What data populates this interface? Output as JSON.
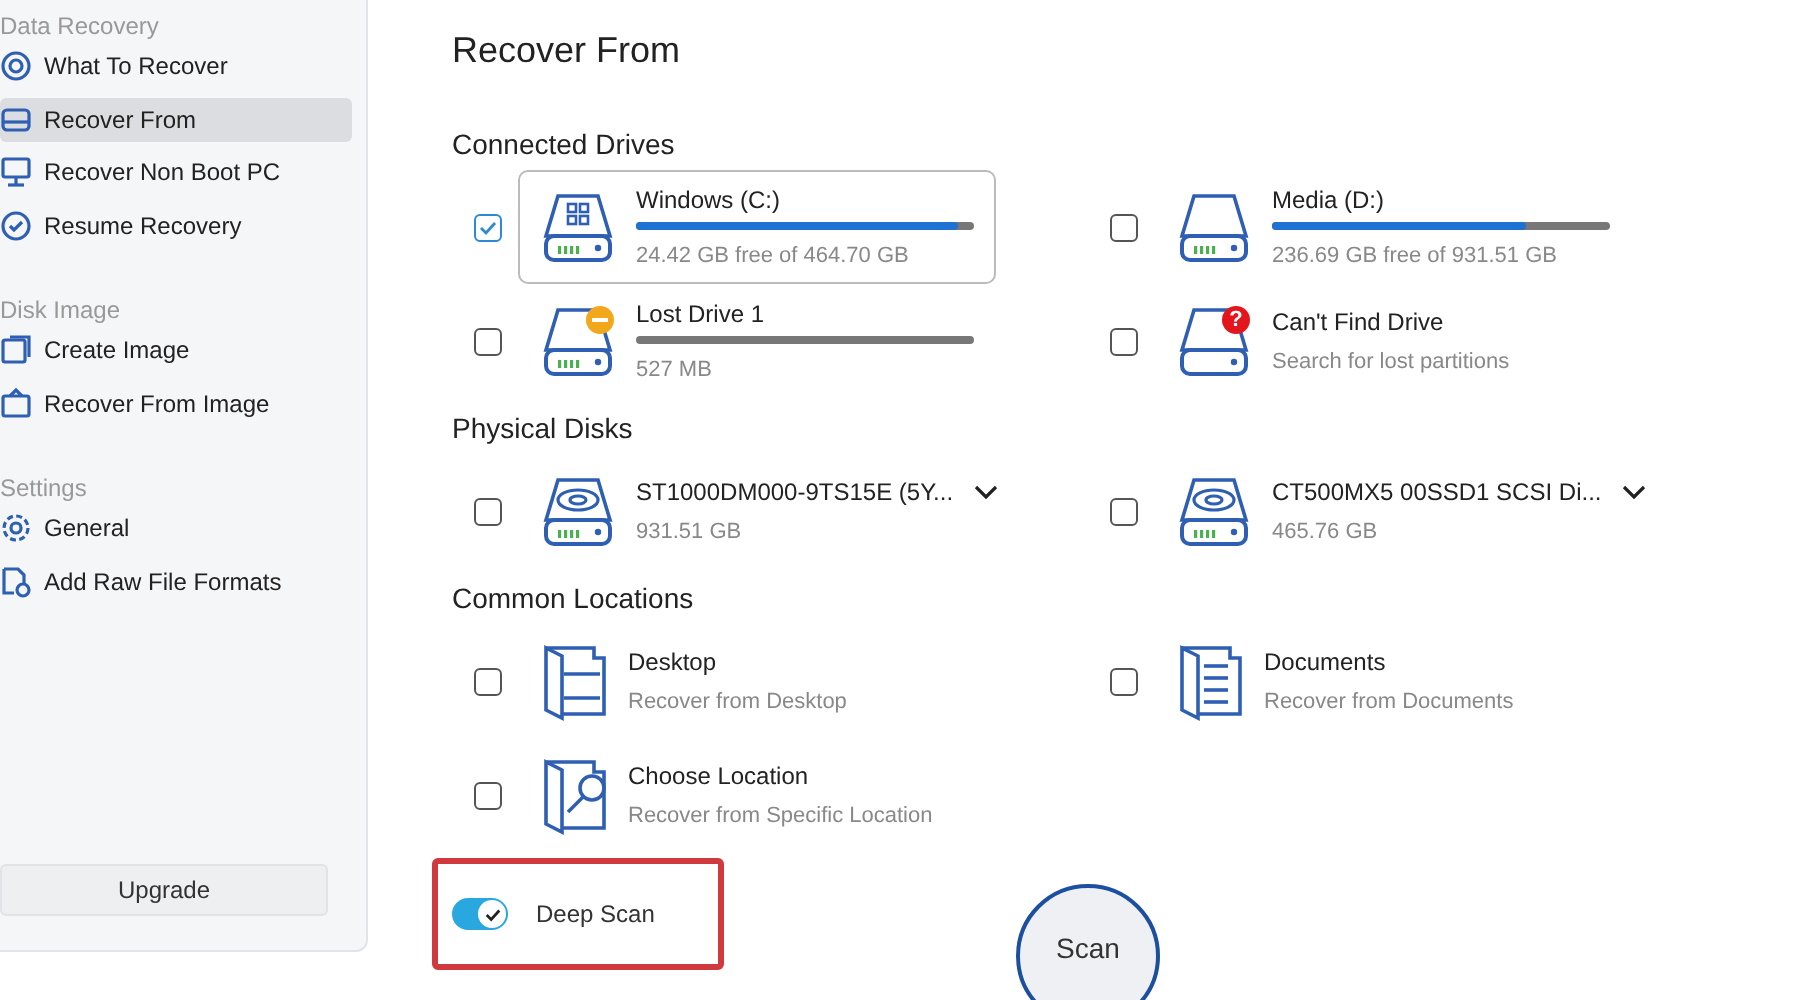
{
  "sidebar": {
    "sections": [
      {
        "heading": "Data Recovery",
        "items": [
          {
            "label": "What To Recover",
            "selected": false
          },
          {
            "label": "Recover From",
            "selected": true
          },
          {
            "label": "Recover Non Boot PC",
            "selected": false
          },
          {
            "label": "Resume Recovery",
            "selected": false
          }
        ]
      },
      {
        "heading": "Disk Image",
        "items": [
          {
            "label": "Create Image",
            "selected": false
          },
          {
            "label": "Recover From Image",
            "selected": false
          }
        ]
      },
      {
        "heading": "Settings",
        "items": [
          {
            "label": "General",
            "selected": false
          },
          {
            "label": "Add Raw File Formats",
            "selected": false
          }
        ]
      }
    ],
    "upgrade_button": "Upgrade"
  },
  "main": {
    "title": "Recover From",
    "sections": [
      {
        "heading": "Connected Drives",
        "items": [
          {
            "kind": "system",
            "name": "Windows (C:)",
            "detail": "24.42 GB free of 464.70 GB",
            "level": 0.95,
            "checked": true,
            "selected": true
          },
          {
            "kind": "volume",
            "name": "Media (D:)",
            "detail": "236.69 GB free of 931.51 GB",
            "level": 0.75,
            "checked": false,
            "selected": false
          },
          {
            "kind": "lost",
            "name": "Lost Drive 1",
            "detail": "527 MB",
            "checked": false,
            "selected": false
          },
          {
            "kind": "unknown",
            "badge": "?",
            "name": "Can't Find Drive",
            "detail": "Search for lost partitions",
            "checked": false,
            "selected": false
          }
        ]
      },
      {
        "heading": "Physical Disks",
        "items": [
          {
            "kind": "disk",
            "name": "ST1000DM000-9TS15E (5Y...",
            "detail": "931.51 GB",
            "checked": false,
            "selected": false
          },
          {
            "kind": "disk",
            "name": "CT500MX5 00SSD1 SCSI Di...",
            "detail": "465.76 GB",
            "checked": false,
            "selected": false
          }
        ]
      },
      {
        "heading": "Common Locations",
        "items": [
          {
            "kind": "desktop",
            "name": "Desktop",
            "detail": "Recover from Desktop",
            "checked": false,
            "selected": false
          },
          {
            "kind": "documents",
            "name": "Documents",
            "detail": "Recover from Documents",
            "checked": false,
            "selected": false
          },
          {
            "kind": "location",
            "name": "Choose Location",
            "detail": "Recover from Specific Location",
            "checked": false,
            "selected": false
          }
        ]
      }
    ],
    "deep_scan": {
      "label": "Deep Scan",
      "on": true
    },
    "scan_button": "Scan"
  }
}
